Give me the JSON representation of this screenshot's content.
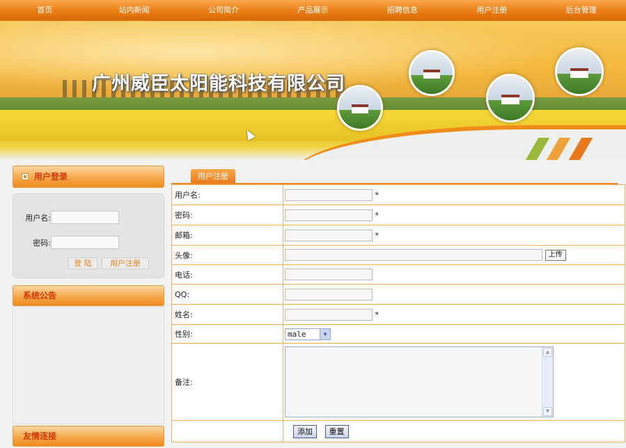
{
  "nav": [
    "首页",
    "站内新闻",
    "公司简介",
    "产品展示",
    "招聘信息",
    "用户注册",
    "后台管理"
  ],
  "banner": {
    "company_name": "广州威臣太阳能科技有限公司"
  },
  "login": {
    "title": "用户登录",
    "username_label": "用户名:",
    "password_label": "密码:",
    "login_button": "登 陆",
    "register_button": "用户注册"
  },
  "notice": {
    "title": "系统公告"
  },
  "links": {
    "title": "友情连接"
  },
  "form": {
    "tab": "用户注册",
    "rows": {
      "username": {
        "label": "用户名:",
        "required": "*"
      },
      "password": {
        "label": "密码:",
        "required": "*"
      },
      "email": {
        "label": "邮箱:",
        "required": "*"
      },
      "avatar": {
        "label": "头像:",
        "upload": "上传"
      },
      "phone": {
        "label": "电话:"
      },
      "qq": {
        "label": "QQ:"
      },
      "name": {
        "label": "姓名:",
        "required": "*"
      },
      "gender": {
        "label": "性别:",
        "selected": "male"
      },
      "remark": {
        "label": "备注:"
      }
    },
    "add_button": "添加",
    "reset_button": "重置"
  },
  "colors": {
    "accent": "#e8781a",
    "nav_bg": "#e87a10",
    "title_red": "#d03a0a",
    "table_border": "#f0b060"
  }
}
